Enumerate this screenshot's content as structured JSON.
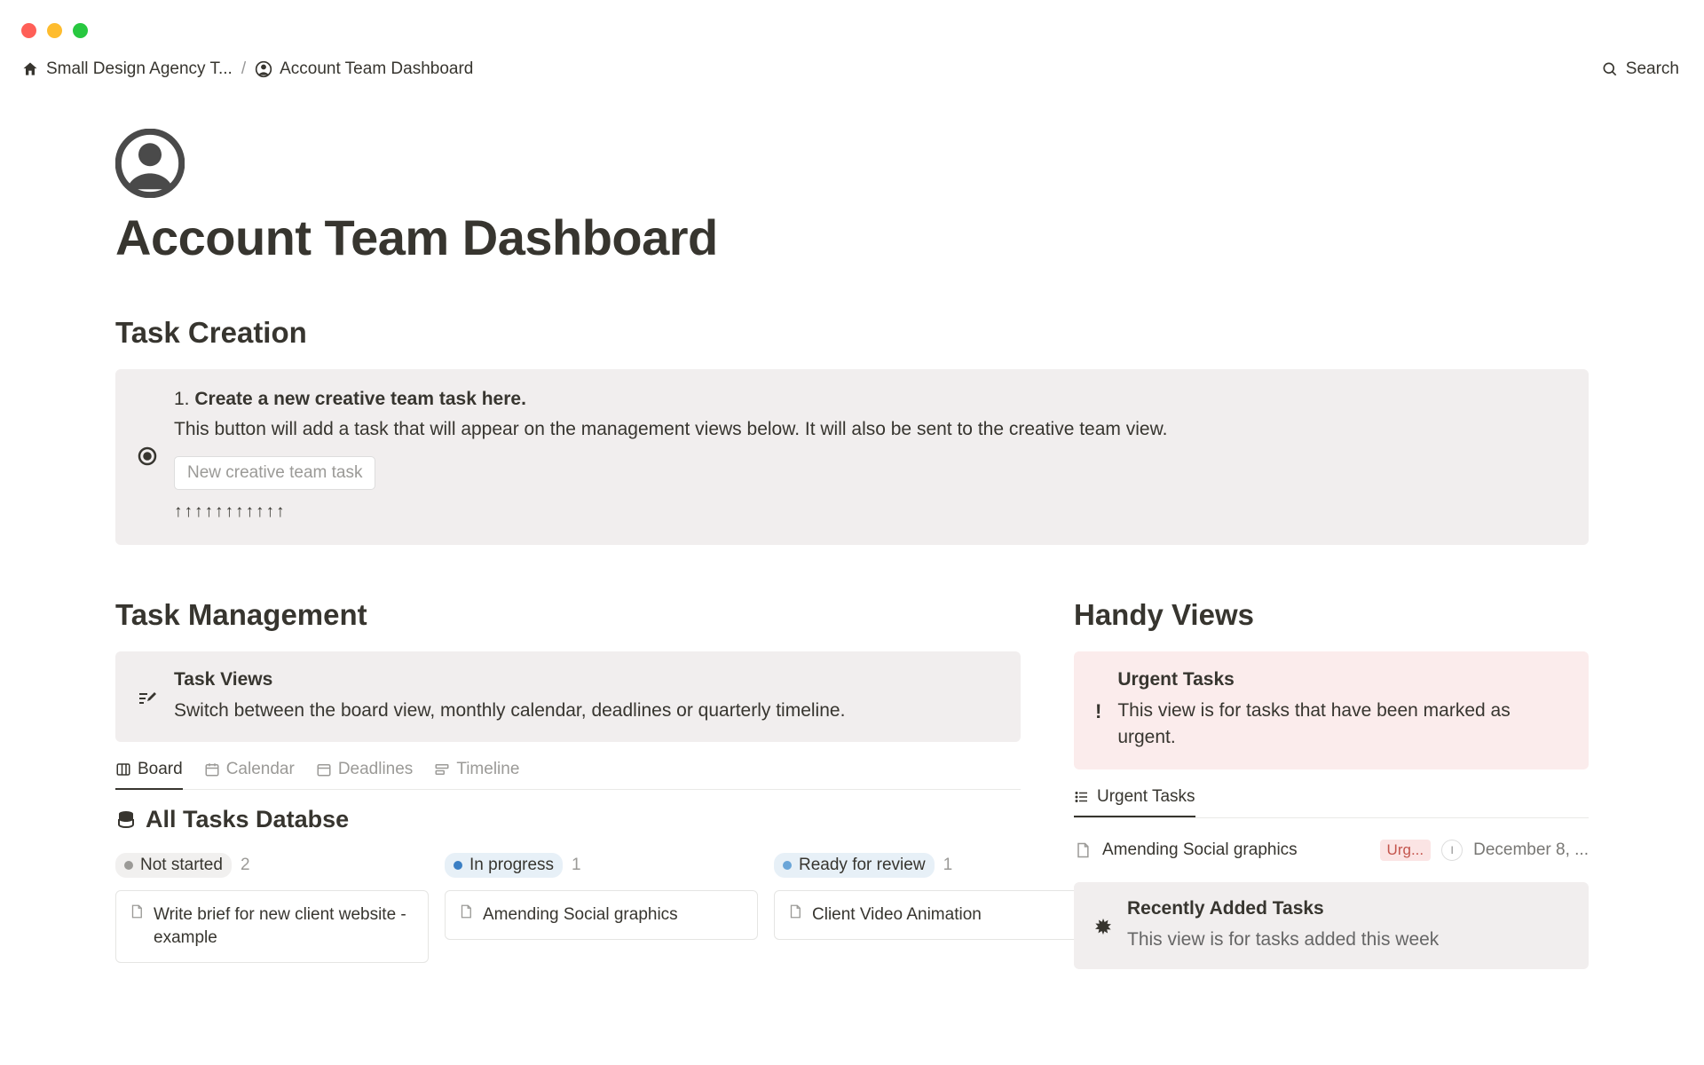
{
  "breadcrumb": {
    "parent": "Small Design Agency T...",
    "current": "Account Team Dashboard"
  },
  "topbar": {
    "search": "Search"
  },
  "page": {
    "title": "Account Team Dashboard"
  },
  "taskCreation": {
    "heading": "Task Creation",
    "calloutNumber": "1. ",
    "calloutBold": "Create a new creative team task here.",
    "calloutDesc": "This button will add a task that will appear on the management views below. It will also be sent to the creative team view.",
    "buttonLabel": "New creative team task",
    "arrows": "↑↑↑↑↑↑↑↑↑↑↑"
  },
  "taskManagement": {
    "heading": "Task Management",
    "viewsTitle": "Task Views",
    "viewsDesc": "Switch between the board view, monthly calendar, deadlines or quarterly timeline.",
    "tabs": {
      "board": "Board",
      "calendar": "Calendar",
      "deadlines": "Deadlines",
      "timeline": "Timeline"
    },
    "dbTitle": "All Tasks Databse",
    "columns": [
      {
        "name": "Not started",
        "count": "2",
        "pillClass": "pill-gray",
        "card": "Write brief for new client website - example"
      },
      {
        "name": "In progress",
        "count": "1",
        "pillClass": "pill-blue",
        "card": "Amending Social graphics"
      },
      {
        "name": "Ready for review",
        "count": "1",
        "pillClass": "pill-lightblue",
        "card": "Client Video Animation"
      }
    ]
  },
  "handyViews": {
    "heading": "Handy Views",
    "urgentTitle": "Urgent Tasks",
    "urgentDesc": "This view is for tasks that have been marked as urgent.",
    "tabLabel": "Urgent Tasks",
    "item": {
      "title": "Amending Social graphics",
      "badge": "Urg...",
      "date": "December 8, ..."
    },
    "recentTitle": "Recently Added Tasks",
    "recentDesc": "This view is for tasks added this week"
  }
}
